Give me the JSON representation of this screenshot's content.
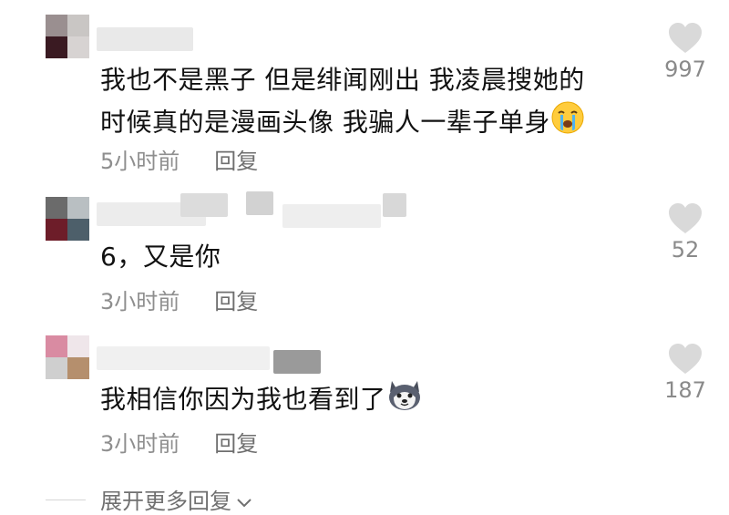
{
  "comments": [
    {
      "text_lines": [
        "我也不是黑子 但是绯闻刚出 我凌晨搜她的",
        "时候真的是漫画头像 我骗人一辈子单身"
      ],
      "emoji": "crying-face",
      "time": "5小时前",
      "reply": "回复",
      "likes": "997"
    },
    {
      "text_lines": [
        "6，又是你"
      ],
      "time": "3小时前",
      "reply": "回复",
      "likes": "52"
    },
    {
      "text_lines": [
        "我相信你因为我也看到了"
      ],
      "emoji": "husky-face",
      "time": "3小时前",
      "reply": "回复",
      "likes": "187"
    }
  ],
  "more_replies": "展开更多回复",
  "colors": {
    "text": "#111111",
    "meta": "#8e8e8e",
    "like_icon": "#d9d9d9"
  }
}
